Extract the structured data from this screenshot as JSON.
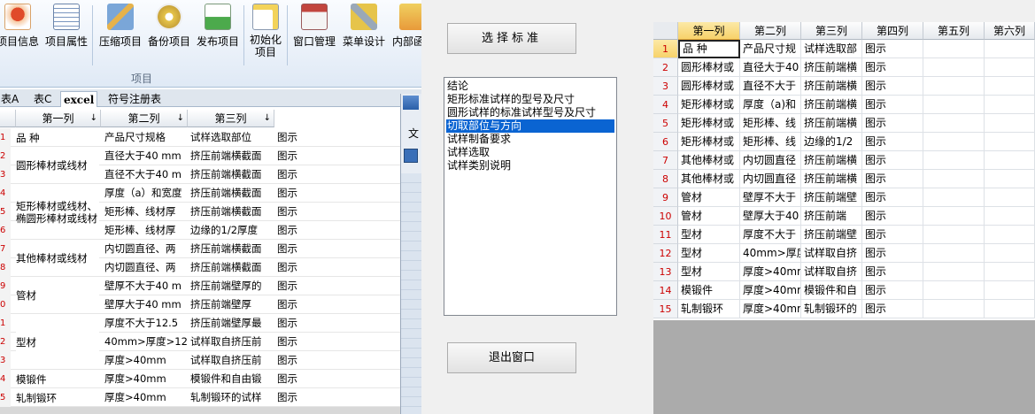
{
  "ribbon": {
    "buttons": [
      "项目信息",
      "项目属性",
      "压缩项目",
      "备份项目",
      "发布项目",
      "初始化\n项目",
      "窗口管理",
      "菜单设计",
      "内部函"
    ],
    "group_label": "项目"
  },
  "sheet_tabs": [
    "表A",
    "表C",
    "excel",
    "符号注册表"
  ],
  "left_grid": {
    "headers": [
      "第一列",
      "第二列",
      "第三列"
    ],
    "rows": [
      {
        "n": "1",
        "c2": "产品尺寸规格",
        "c3": "试样选取部位",
        "c4": "图示"
      },
      {
        "n": "2",
        "c2": "直径大于40 mm",
        "c3": "挤压前端横截面",
        "c4": "图示"
      },
      {
        "n": "3",
        "c2": "直径不大于40 m",
        "c3": "挤压前端横截面",
        "c4": "图示"
      },
      {
        "n": "4",
        "c2": "厚度（a）和宽度",
        "c3": "挤压前端横截面",
        "c4": "图示"
      },
      {
        "n": "5",
        "c2": "矩形棒、线材厚",
        "c3": "挤压前端横截面",
        "c4": "图示"
      },
      {
        "n": "6",
        "c2": "矩形棒、线材厚",
        "c3": "边缘的1/2厚度",
        "c4": "图示"
      },
      {
        "n": "7",
        "c2": "内切圆直径、两",
        "c3": "挤压前端横截面",
        "c4": "图示"
      },
      {
        "n": "8",
        "c2": "内切圆直径、两",
        "c3": "挤压前端横截面",
        "c4": "图示"
      },
      {
        "n": "9",
        "c2": "壁厚不大于40 m",
        "c3": "挤压前端壁厚的",
        "c4": "图示"
      },
      {
        "n": "0",
        "c2": "壁厚大于40 mm",
        "c3": "挤压前端壁厚",
        "c4": "图示"
      },
      {
        "n": "1",
        "c2": "厚度不大于12.5",
        "c3": "挤压前端壁厚最",
        "c4": "图示"
      },
      {
        "n": "2",
        "c2": "40mm>厚度>12.5",
        "c3": "试样取自挤压前",
        "c4": "图示"
      },
      {
        "n": "3",
        "c2": "厚度>40mm",
        "c3": "试样取自挤压前",
        "c4": "图示"
      },
      {
        "n": "4",
        "c2": "厚度>40mm",
        "c3": "模锻件和自由锻",
        "c4": "图示"
      },
      {
        "n": "5",
        "c2": "厚度>40mm",
        "c3": "轧制锻环的试样",
        "c4": "图示"
      }
    ],
    "merged_first_col": [
      {
        "text": "品 种",
        "row": 0,
        "span": 1
      },
      {
        "text": "圆形棒材或线材",
        "row": 1,
        "span": 2
      },
      {
        "text": "矩形棒材或线材、椭圆形棒材或线材",
        "row": 3,
        "span": 3
      },
      {
        "text": "其他棒材或线材",
        "row": 6,
        "span": 2
      },
      {
        "text": "管材",
        "row": 8,
        "span": 2
      },
      {
        "text": "型材",
        "row": 10,
        "span": 3
      },
      {
        "text": "模锻件",
        "row": 13,
        "span": 1
      },
      {
        "text": "轧制锻环",
        "row": 14,
        "span": 1
      }
    ]
  },
  "child_window": {
    "menu_label": "文"
  },
  "dialog": {
    "select_button": "选择标准",
    "exit_button": "退出窗口",
    "list_items": [
      "结论",
      "矩形标准试样的型号及尺寸",
      "圆形试样的标准试样型号及尺寸",
      "切取部位与方向",
      "试样制备要求",
      "试样选取",
      "试样类别说明"
    ],
    "selected_index": 3
  },
  "right_grid": {
    "headers": [
      "第一列",
      "第二列",
      "第三列",
      "第四列",
      "第五列",
      "第六列"
    ],
    "rows": [
      [
        "品 种",
        "产品尺寸规",
        "试样选取部",
        "图示"
      ],
      [
        "圆形棒材或",
        "直径大于40",
        "挤压前端横",
        "图示"
      ],
      [
        "圆形棒材或",
        "直径不大于",
        "挤压前端横",
        "图示"
      ],
      [
        "矩形棒材或",
        "厚度（a)和",
        "挤压前端横",
        "图示"
      ],
      [
        "矩形棒材或",
        "矩形棒、线",
        "挤压前端横",
        "图示"
      ],
      [
        "矩形棒材或",
        "矩形棒、线",
        "边缘的1/2",
        "图示"
      ],
      [
        "其他棒材或",
        "内切圆直径",
        "挤压前端横",
        "图示"
      ],
      [
        "其他棒材或",
        "内切圆直径",
        "挤压前端横",
        "图示"
      ],
      [
        "管材",
        "壁厚不大于",
        "挤压前端壁",
        "图示"
      ],
      [
        "管材",
        "壁厚大于40",
        "挤压前端",
        "图示"
      ],
      [
        "型材",
        "厚度不大于",
        "挤压前端壁",
        "图示"
      ],
      [
        "型材",
        "40mm>厚度>",
        "试样取自挤",
        "图示"
      ],
      [
        "型材",
        "厚度>40mm",
        "试样取自挤",
        "图示"
      ],
      [
        "模锻件",
        "厚度>40mm",
        "模锻件和自",
        "图示"
      ],
      [
        "轧制锻环",
        "厚度>40mm",
        "轧制锻环的",
        "图示"
      ]
    ]
  }
}
